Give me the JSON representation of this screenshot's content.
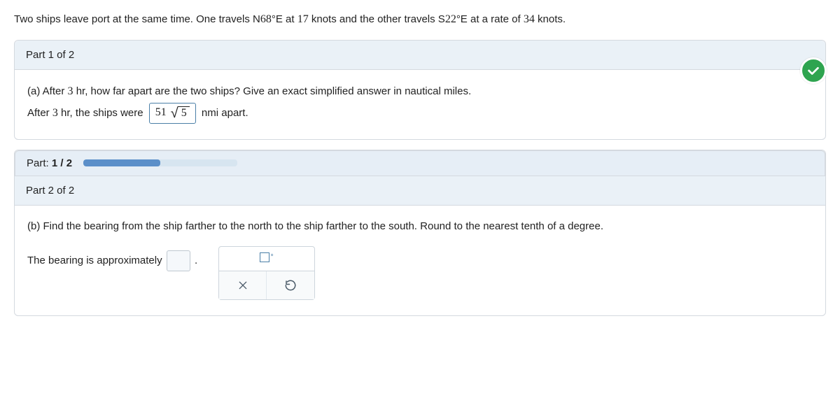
{
  "problem": {
    "prefix": "Two ships leave port at the same time. One travels N",
    "angle1": "68",
    "mid1": "°E at ",
    "speed1": "17",
    "mid2": " knots and the other travels S",
    "angle2": "22",
    "mid3": "°E at a rate of ",
    "speed2": "34",
    "suffix": " knots."
  },
  "part1": {
    "header": "Part 1 of 2",
    "q_prefix": "(a) After ",
    "hours": "3",
    "q_suffix": " hr, how far apart are the two ships? Give an exact simplified answer in nautical miles.",
    "a_prefix": "After ",
    "a_mid": " hr, the ships were ",
    "ans_int": "51",
    "ans_rad": "5",
    "a_suffix": " nmi apart."
  },
  "progress": {
    "label_prefix": "Part: ",
    "current": "1",
    "sep": " / ",
    "total": "2"
  },
  "part2": {
    "header": "Part 2 of 2",
    "question": "(b) Find the bearing from the ship farther to the north to the ship farther to the south. Round to the nearest tenth of a degree.",
    "answer_label": "The bearing is approximately ",
    "period": "."
  }
}
